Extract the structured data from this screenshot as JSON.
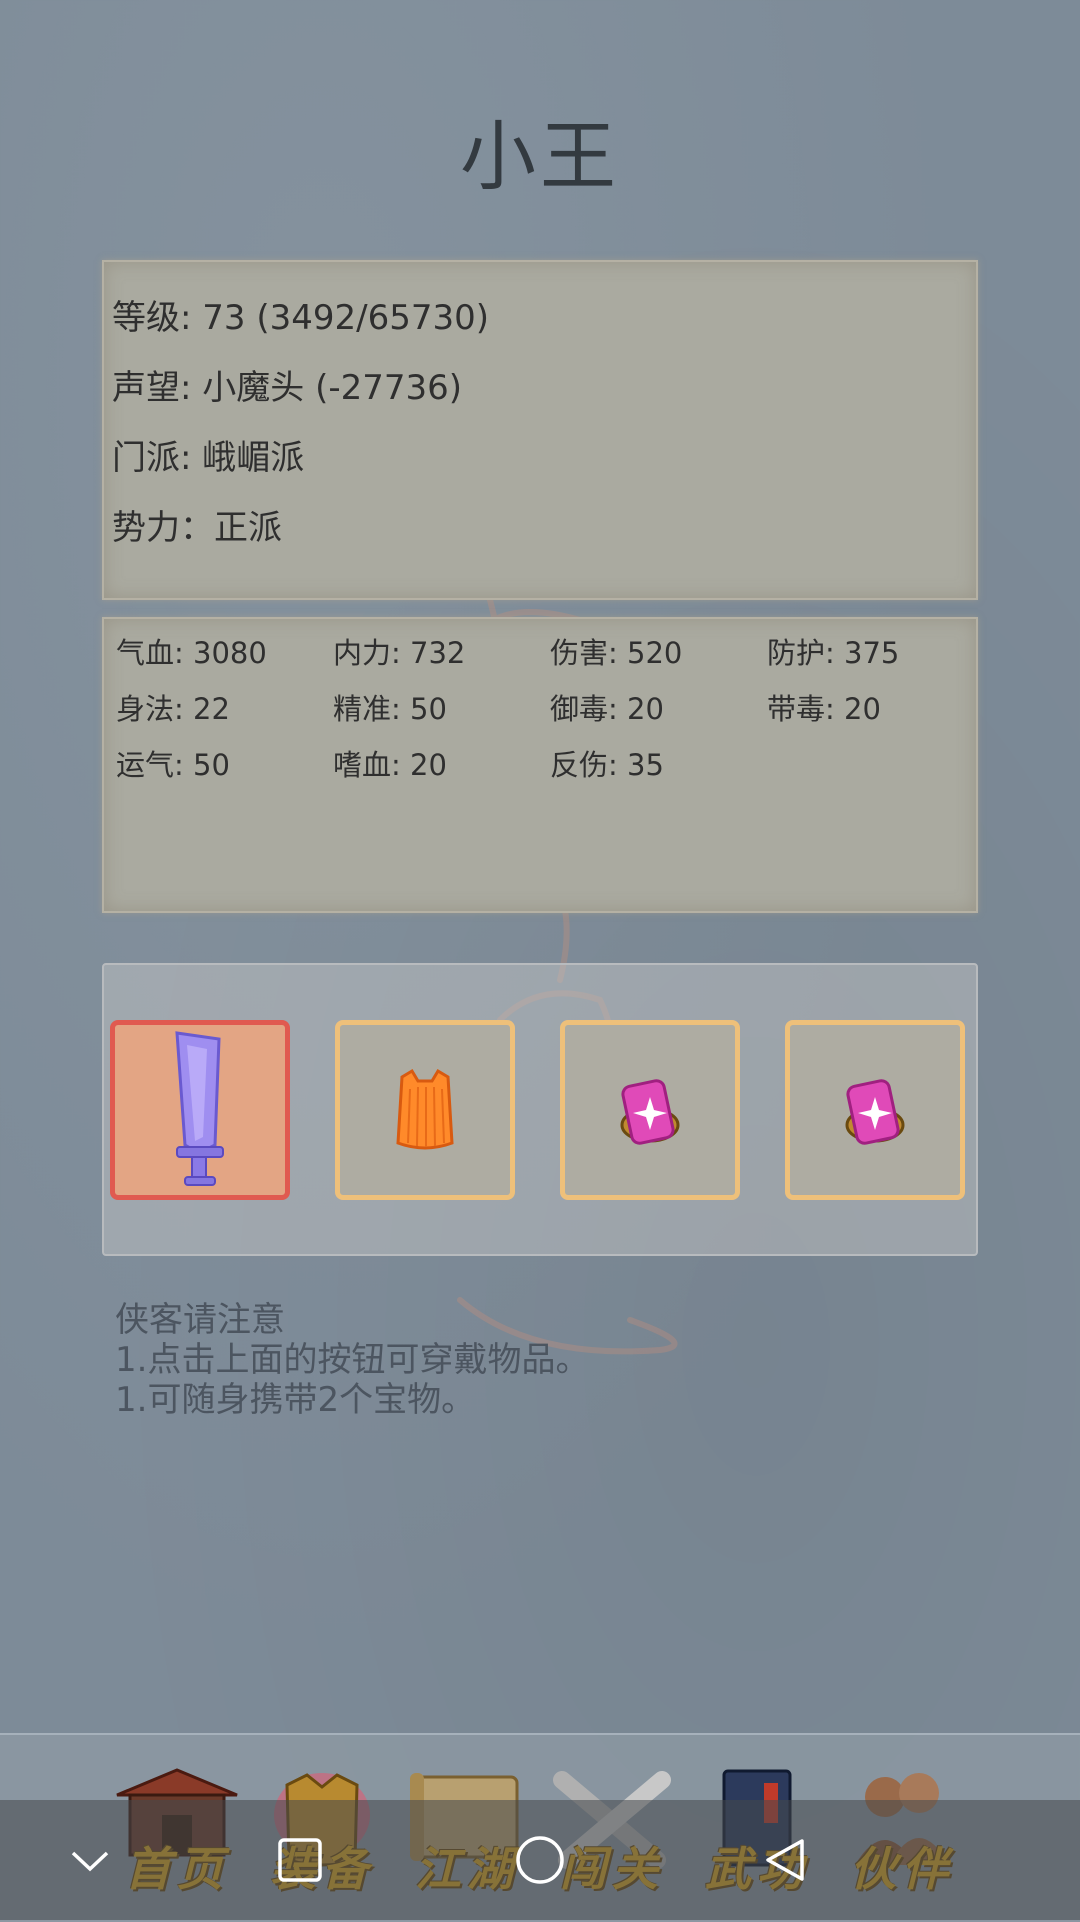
{
  "character": {
    "name": "小王"
  },
  "info": {
    "level": "等级: 73 (3492/65730)",
    "reputation": "声望: 小魔头 (-27736)",
    "sect": "门派: 峨嵋派",
    "faction": "势力：正派"
  },
  "stats": [
    "气血: 3080",
    "内力: 732",
    "伤害: 520",
    "防护: 375",
    "身法: 22",
    "精准: 50",
    "御毒: 20",
    "带毒: 20",
    "运气: 50",
    "嗜血: 20",
    "反伤: 35"
  ],
  "equipment": [
    {
      "name": "sword-icon",
      "selected": true
    },
    {
      "name": "armor-icon",
      "selected": false
    },
    {
      "name": "gem-icon",
      "selected": false
    },
    {
      "name": "gem-icon",
      "selected": false
    }
  ],
  "notice": {
    "title": "侠客请注意",
    "line1": "1.点击上面的按钮可穿戴物品。",
    "line2": "1.可随身携带2个宝物。"
  },
  "tabs": [
    {
      "label": "首页",
      "icon": "house-icon"
    },
    {
      "label": "装备",
      "icon": "armor-icon"
    },
    {
      "label": "江湖",
      "icon": "scroll-icon"
    },
    {
      "label": "闯关",
      "icon": "crossed-swords-icon"
    },
    {
      "label": "武功",
      "icon": "book-icon"
    },
    {
      "label": "伙伴",
      "icon": "companions-icon"
    }
  ],
  "system_nav": [
    "collapse-icon",
    "recents-icon",
    "home-circle-icon",
    "back-icon"
  ]
}
